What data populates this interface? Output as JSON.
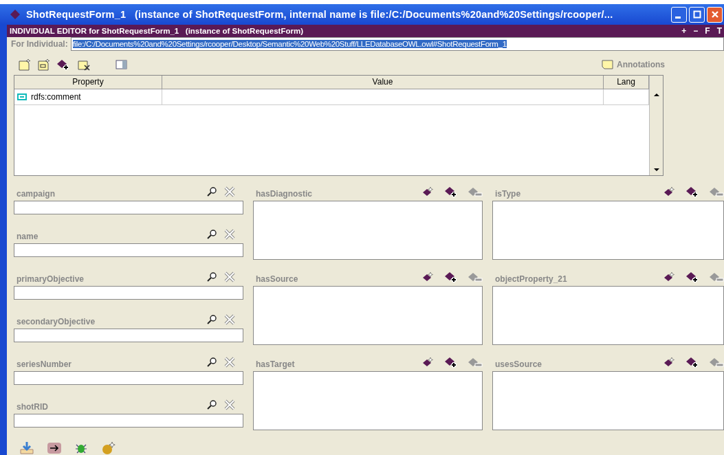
{
  "window": {
    "title": "ShotRequestForm_1   (instance of ShotRequestForm, internal name is file:/C:/Documents%20and%20Settings/rcooper/..."
  },
  "editor_header": {
    "title": "INDIVIDUAL EDITOR for ShotRequestForm_1   (instance of ShotRequestForm)",
    "buttons": [
      "+",
      "−",
      "F",
      "T"
    ]
  },
  "for_individual": {
    "label": "For Individual:",
    "value": "file:/C:/Documents%20and%20Settings/rcooper/Desktop/Semantic%20Web%20Stuff/LLEDatabaseOWL.owl#ShotRequestForm_1",
    "selected": true
  },
  "annotations_button": "Annotations",
  "table": {
    "columns": [
      "Property",
      "Value",
      "Lang"
    ],
    "rows": [
      {
        "property": "rdfs:comment"
      }
    ]
  },
  "datatype_fields": [
    "campaign",
    "name",
    "primaryObjective",
    "secondaryObjective",
    "seriesNumber",
    "shotRID"
  ],
  "object_properties": [
    "hasDiagnostic",
    "isType",
    "hasSource",
    "objectProperty_21",
    "hasTarget",
    "usesSource"
  ]
}
